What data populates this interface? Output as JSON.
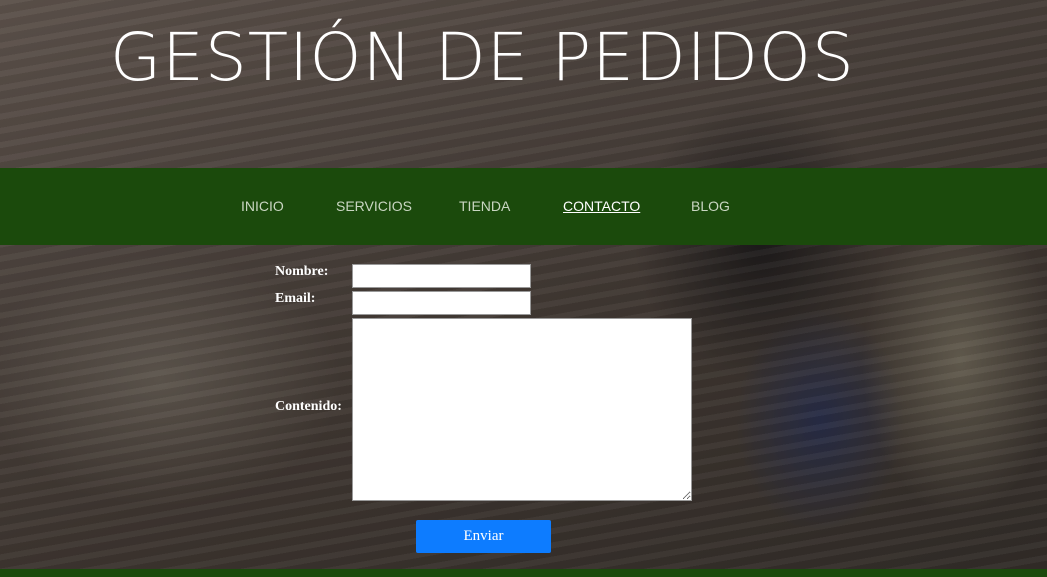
{
  "header": {
    "title": "GESTIÓN DE PEDIDOS"
  },
  "nav": {
    "items": [
      {
        "label": "INICIO",
        "active": false
      },
      {
        "label": "SERVICIOS",
        "active": false
      },
      {
        "label": "TIENDA",
        "active": false
      },
      {
        "label": "CONTACTO",
        "active": true
      },
      {
        "label": "BLOG",
        "active": false
      }
    ]
  },
  "form": {
    "name_label": "Nombre:",
    "name_value": "",
    "email_label": "Email:",
    "email_value": "",
    "content_label": "Contenido:",
    "content_value": "",
    "submit_label": "Enviar"
  },
  "colors": {
    "nav_background": "#1b4a0c",
    "nav_text": "#c9d6c2",
    "nav_active_text": "#ffffff",
    "button_background": "#0d7cff",
    "title_text": "#ffffff"
  }
}
